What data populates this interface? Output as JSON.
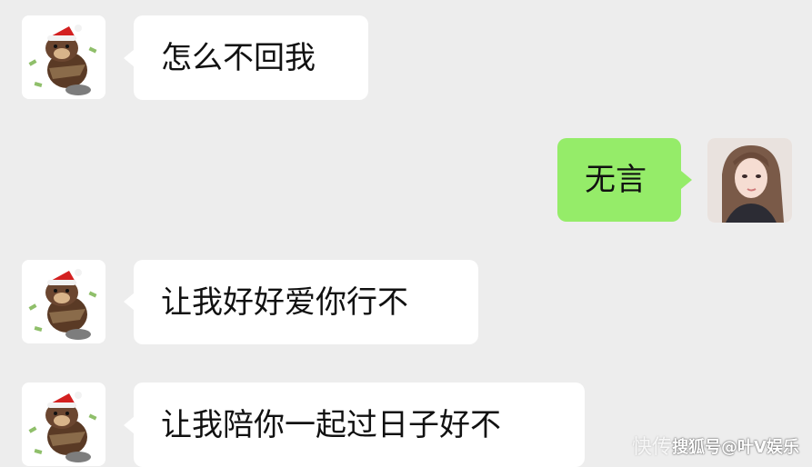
{
  "messages": [
    {
      "side": "left",
      "text": "怎么不回我",
      "avatar": "brown-bear-santa-hat-icon"
    },
    {
      "side": "right",
      "text": "无言",
      "avatar": "girl-portrait-avatar"
    },
    {
      "side": "left",
      "text": "让我好好爱你行不",
      "avatar": "brown-bear-santa-hat-icon"
    },
    {
      "side": "left",
      "text": "让我陪你一起过日子好不",
      "avatar": "brown-bear-santa-hat-icon"
    }
  ],
  "watermark": {
    "faded": "快传",
    "text": "搜狐号@叶V娱乐"
  },
  "colors": {
    "background": "#ededed",
    "bubble_left": "#ffffff",
    "bubble_right": "#95ec69"
  }
}
